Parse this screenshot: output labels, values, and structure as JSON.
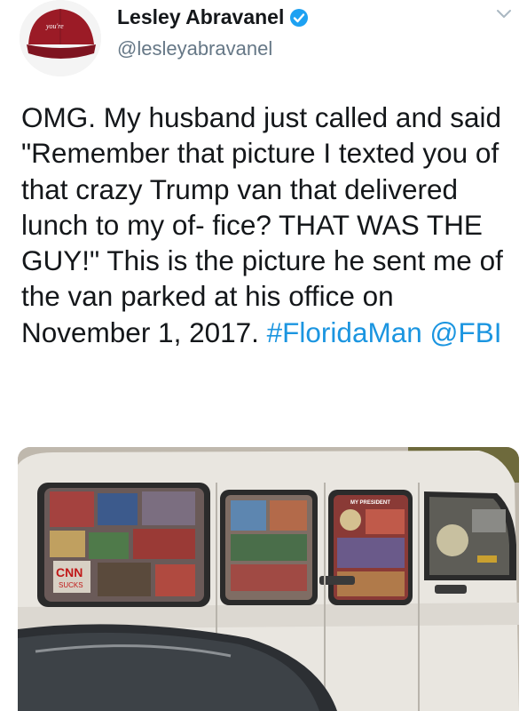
{
  "header": {
    "avatar_text": "you're",
    "display_name": "Lesley Abravanel",
    "handle": "@lesleyabravanel",
    "verified": true
  },
  "tweet": {
    "text_plain": "OMG. My husband just called and said \"Remember that picture I texted you of that crazy Trump van that delivered lunch to my of- fice? THAT WAS THE GUY!\" This is the picture he sent me of the van parked at his office on November 1, 2017. ",
    "hashtag": "#FloridaMan",
    "mention": "@FBI"
  },
  "media": {
    "van_sign_text": "MY PRESIDENT",
    "cnn_text": "CNN",
    "sucks_text": "SUCKS"
  },
  "colors": {
    "link": "#1b95e0",
    "handle": "#657786",
    "verified": "#1da1f2",
    "text": "#14171a"
  }
}
